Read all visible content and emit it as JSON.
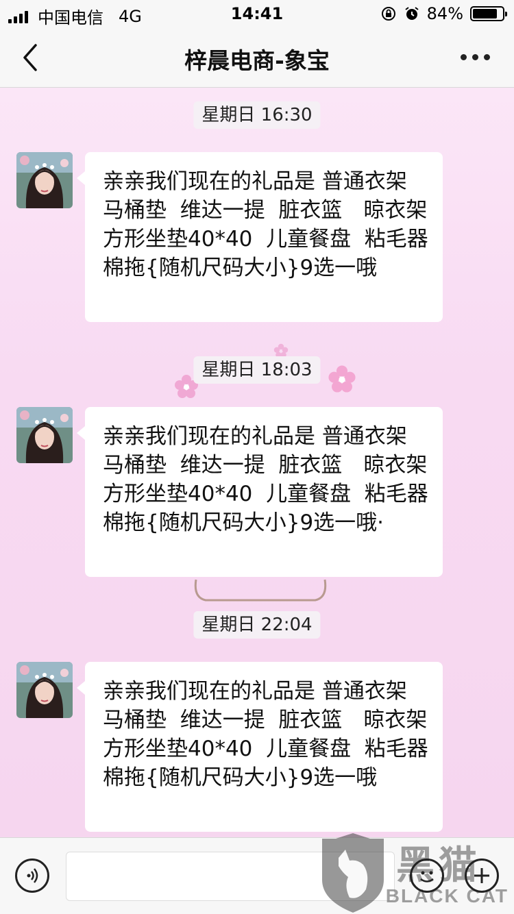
{
  "status": {
    "carrier": "中国电信",
    "network": "4G",
    "time": "14:41",
    "battery": "84%",
    "battery_level": 0.84
  },
  "nav": {
    "title": "梓晨电商-象宝"
  },
  "messages": [
    {
      "timestamp": "星期日 16:30",
      "text": "亲亲我们现在的礼品是 普通衣架　马桶垫  维达一提  脏衣篮　晾衣架　 方形坐垫40*40  儿童餐盘  粘毛器　棉拖{随机尺码大小}9选一哦"
    },
    {
      "timestamp": "星期日 18:03",
      "text": "亲亲我们现在的礼品是 普通衣架　马桶垫  维达一提  脏衣篮　晾衣架　 方形坐垫40*40  儿童餐盘  粘毛器　棉拖{随机尺码大小}9选一哦·"
    },
    {
      "timestamp": "星期日 22:04",
      "text": "亲亲我们现在的礼品是 普通衣架　马桶垫  维达一提  脏衣篮　晾衣架　 方形坐垫40*40  儿童餐盘  粘毛器　棉拖{随机尺码大小}9选一哦"
    }
  ],
  "watermark": {
    "text": "BLACK CAT",
    "cn_text": "黑猫"
  },
  "colors": {
    "chat_background": "#f8daf2",
    "bubble": "#ffffff",
    "bar": "#f7f7f7"
  }
}
